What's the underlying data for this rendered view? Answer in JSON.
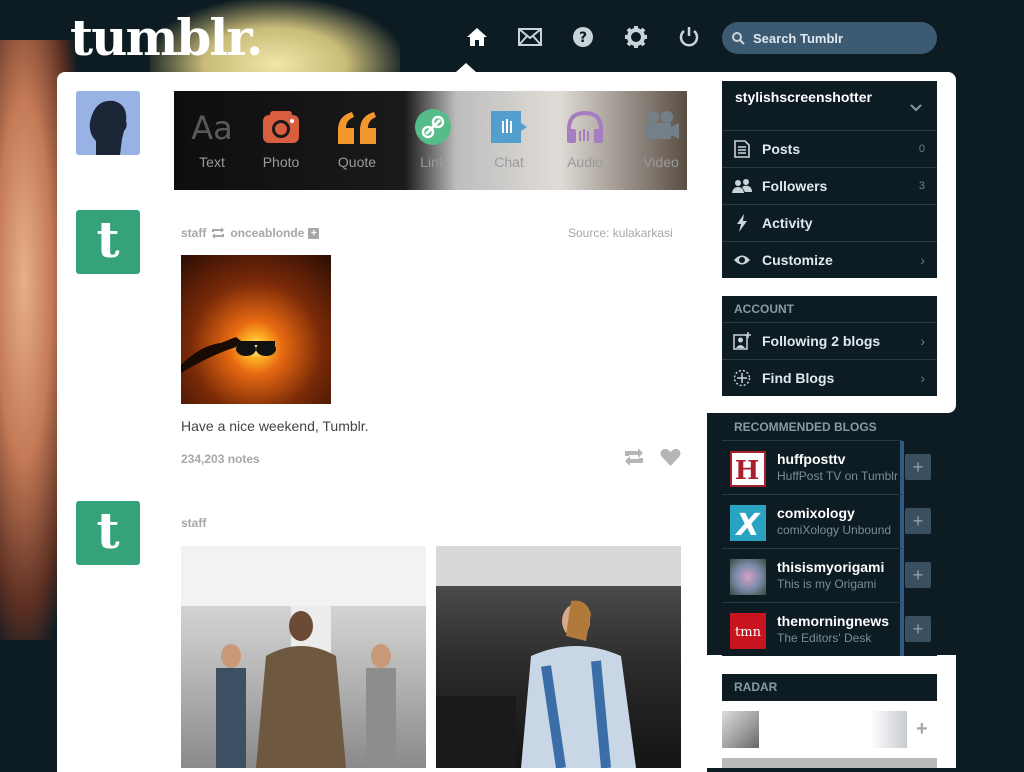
{
  "header": {
    "logo": "tumblr.",
    "search_placeholder": "Search Tumblr"
  },
  "post_types": [
    {
      "label": "Text",
      "icon": "text-icon",
      "color": "#cfcfcf"
    },
    {
      "label": "Photo",
      "icon": "camera-icon",
      "color": "#d95e40"
    },
    {
      "label": "Quote",
      "icon": "quote-icon",
      "color": "#f2992e"
    },
    {
      "label": "Link",
      "icon": "link-icon",
      "color": "#56bc8a"
    },
    {
      "label": "Chat",
      "icon": "chat-icon",
      "color": "#529ecc"
    },
    {
      "label": "Audio",
      "icon": "headphones-icon",
      "color": "#a77dc2"
    },
    {
      "label": "Video",
      "icon": "video-icon",
      "color": "#748089"
    }
  ],
  "post1": {
    "author": "staff",
    "reblogged_from": "onceablonde",
    "source_label": "Source:",
    "source": "kulakarkasi",
    "caption": "Have a nice weekend, Tumblr.",
    "notes": "234,203 notes"
  },
  "post2": {
    "author": "staff"
  },
  "sidebar": {
    "blog_name": "stylishscreenshotter",
    "items": [
      {
        "label": "Posts",
        "count": "0"
      },
      {
        "label": "Followers",
        "count": "3"
      },
      {
        "label": "Activity"
      },
      {
        "label": "Customize"
      }
    ],
    "account_header": "ACCOUNT",
    "account_items": [
      {
        "label": "Following 2 blogs"
      },
      {
        "label": "Find Blogs"
      }
    ],
    "recommended_header": "RECOMMENDED BLOGS",
    "recommended": [
      {
        "name": "huffposttv",
        "desc": "HuffPost TV on Tumblr"
      },
      {
        "name": "comixology",
        "desc": "comiXology Unbound"
      },
      {
        "name": "thisismyorigami",
        "desc": "This is my Origami"
      },
      {
        "name": "themorningnews",
        "desc": "The Editors' Desk"
      }
    ],
    "radar_header": "RADAR"
  },
  "colors": {
    "background": "#0d1b22",
    "search_bg": "#3d5a73",
    "tumblr_green": "#35a27a"
  }
}
